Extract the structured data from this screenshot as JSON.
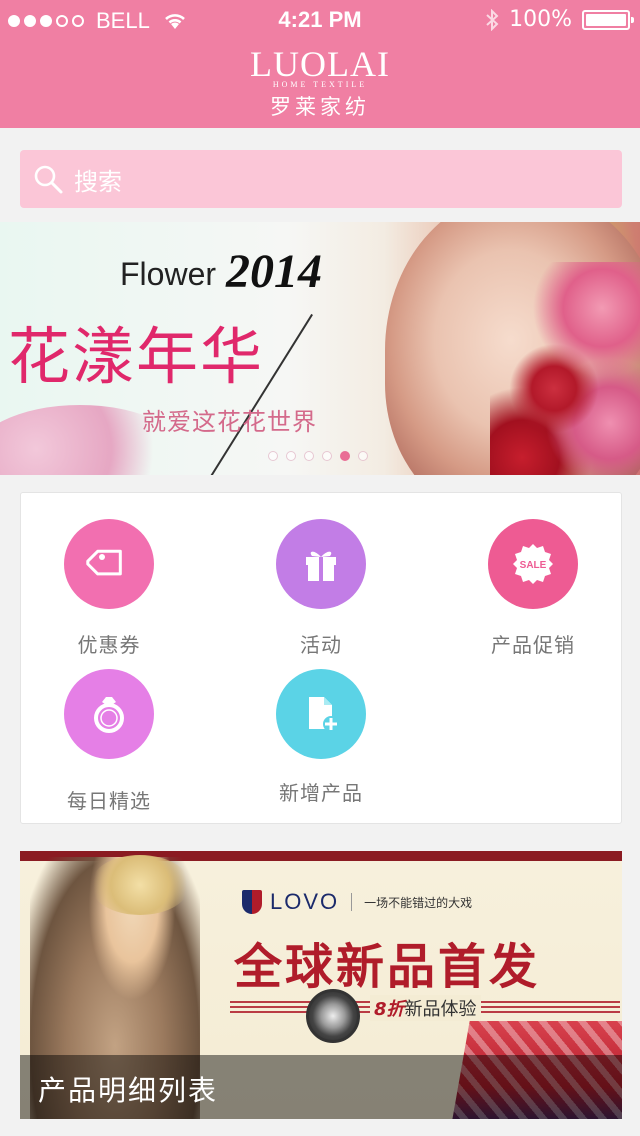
{
  "status_bar": {
    "carrier": "BELL",
    "time": "4:21 PM",
    "battery": "100%",
    "signal_bars_filled": 3,
    "signal_bars_total": 5
  },
  "header": {
    "logo_mark": "LUOLAI",
    "logo_sub": "HOME TEXTILE",
    "logo_cn": "罗莱家纺"
  },
  "search": {
    "placeholder": "搜索"
  },
  "banner": {
    "word": "Flower",
    "year": "2014",
    "title": "花漾年华",
    "tagline": "就爱这花花世界",
    "pages_total": 6,
    "active_page": 5
  },
  "menu": {
    "items": [
      {
        "label": "优惠券",
        "icon": "tag-icon",
        "color": "#f26fb0"
      },
      {
        "label": "活动",
        "icon": "gift-icon",
        "color": "#c27de6"
      },
      {
        "label": "产品促销",
        "icon": "sale-icon",
        "color": "#ee5b93"
      },
      {
        "label": "每日精选",
        "icon": "ring-icon",
        "color": "#e57fe6"
      },
      {
        "label": "新增产品",
        "icon": "new-document-icon",
        "color": "#5bd3e6"
      }
    ]
  },
  "promo": {
    "brand": "LOVO",
    "slogan": "一场不能错过的大戏",
    "headline": "全球新品首发",
    "offer_prefix": "8折",
    "offer_text": "新品体验",
    "caption": "产品明细列表"
  }
}
